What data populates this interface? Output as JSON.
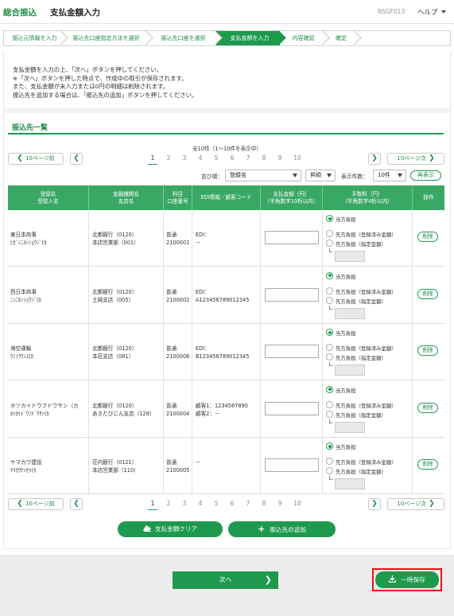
{
  "header": {
    "app_name": "総合振込",
    "page_title": "支払金額入力",
    "screen_code": "BSGF013",
    "help_label": "ヘルプ"
  },
  "steps": [
    {
      "label": "振込元情報を入力",
      "active": false
    },
    {
      "label": "振込先口座指定方法を選択",
      "active": false
    },
    {
      "label": "振込先口座を選択",
      "active": false
    },
    {
      "label": "支払金額を入力",
      "active": true
    },
    {
      "label": "内容確認",
      "active": false
    },
    {
      "label": "確定",
      "active": false
    }
  ],
  "instructions": [
    "支払金額を入力の上、「次へ」ボタンを押してください。",
    "※「次へ」ボタンを押した時点で、作成中の取引が保存されます。",
    "また、支払金額が未入力または0円の明細は削除されます。",
    "振込先を追加する場合は、「振込先の追加」ボタンを押してください。"
  ],
  "section_title": "振込先一覧",
  "count_text": "全10件（1～10件を表示中）",
  "pager": {
    "prev10": "10ページ前",
    "next10": "10ページ次",
    "pages": [
      "1",
      "2",
      "3",
      "4",
      "5",
      "6",
      "7",
      "8",
      "9",
      "10"
    ],
    "current": "1"
  },
  "sort": {
    "sort_label": "並び順：",
    "sort_value": "登録名",
    "order_value": "昇順",
    "count_label": "表示件数：",
    "count_value": "10件",
    "redisplay": "再表示"
  },
  "table": {
    "headers": [
      {
        "l1": "登録名",
        "l2": "受取人名"
      },
      {
        "l1": "金融機関名",
        "l2": "支店名"
      },
      {
        "l1": "科目",
        "l2": "口座番号"
      },
      {
        "l1": "EDI情報／顧客コード",
        "l2": ""
      },
      {
        "l1": "支払金額（円）",
        "l2": "（半角数字10桁以内）"
      },
      {
        "l1": "手数料（円）",
        "l2": "（半角数字4桁以内）"
      },
      {
        "l1": "操作",
        "l2": ""
      }
    ],
    "rows": [
      {
        "name": "東日本商事",
        "kana": "ﾋｶﾞｼﾆﾎﾝｼｮｳｼﾞ(ｶ",
        "bank": "北都銀行（0120）",
        "branch": "本店営業部（001）",
        "type": "普通",
        "account": "2100001",
        "edi1": "EDI：",
        "edi2": "－"
      },
      {
        "name": "西日本商事",
        "kana": "ﾆｼﾆﾎﾝｼｮｳｼﾞ(ｶ",
        "bank": "北都銀行（0120）",
        "branch": "土崎支店（005）",
        "type": "普通",
        "account": "2100002",
        "edi1": "EDI：",
        "edi2": "A123456789012345"
      },
      {
        "name": "海空運輸",
        "kana": "ｳﾐｿﾗｳﾝﾕ(ｶ",
        "bank": "北都銀行（0120）",
        "branch": "本荘支店（081）",
        "type": "普通",
        "account": "2100006",
        "edi1": "EDI：",
        "edi2": "B123456789012345"
      },
      {
        "name": "ホツカイドウフドウサン（カ",
        "kana": "ﾎﾂｶｲﾄﾞｳﾌﾄﾞｳｻﾝ(ｶ",
        "bank": "北都銀行（0120）",
        "branch": "あきたびじん支店（128）",
        "type": "普通",
        "account": "2100004",
        "edi1": "顧客1：1234567890",
        "edi2": "顧客2：－"
      },
      {
        "name": "ヤマカワ建設",
        "kana": "ﾔﾏｶﾜｹﾝｾﾂ(ｶ",
        "bank": "荘内銀行（0121）",
        "branch": "本店営業部（110）",
        "type": "普通",
        "account": "2100005",
        "edi1": "－",
        "edi2": ""
      }
    ],
    "fee_options": {
      "self": "当方負担",
      "payee_registered": "先方負担（登録済み金額）",
      "payee_specified": "先方負担（指定金額）"
    },
    "delete_label": "削除"
  },
  "actions": {
    "clear_amount": "支払金額クリア",
    "add_payee": "振込先の追加"
  },
  "footer": {
    "next": "次へ",
    "save": "一時保存"
  },
  "colors": {
    "brand_green": "#1e9a4f",
    "header_green": "#3aa865",
    "highlight_red": "#e11111"
  }
}
